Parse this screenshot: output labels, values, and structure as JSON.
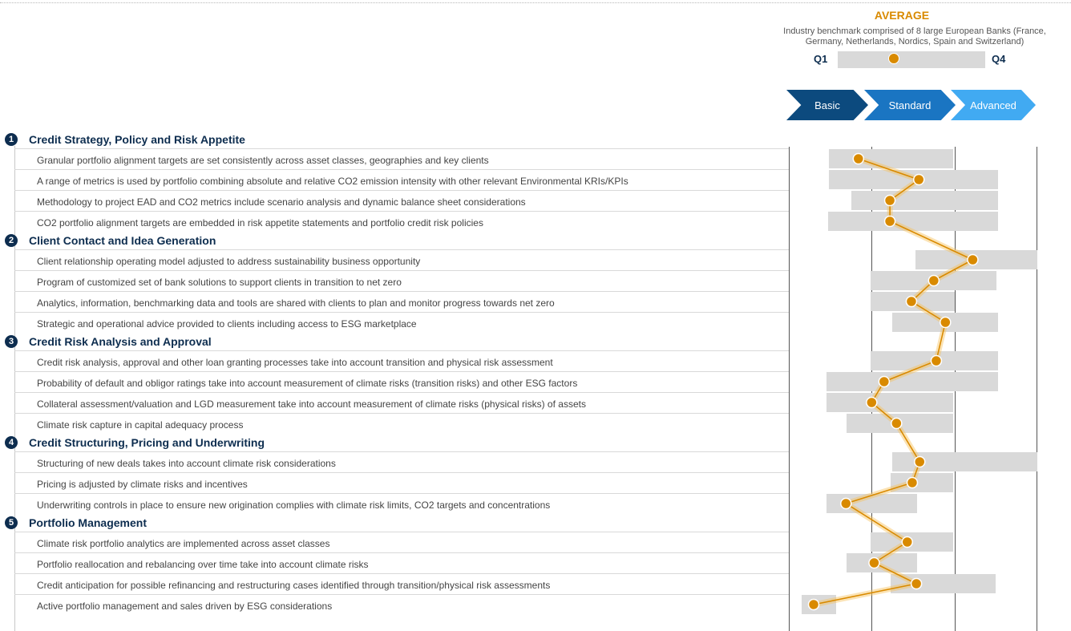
{
  "legend": {
    "title": "AVERAGE",
    "subtitle_line1": "Industry benchmark comprised of 8 large European Banks (France,",
    "subtitle_line2": "Germany, Netherlands, Nordics, Spain and Switzerland)",
    "q1": "Q1",
    "q4": "Q4",
    "sample_average": 0.38
  },
  "maturity_levels": [
    "Basic",
    "Standard",
    "Advanced"
  ],
  "colors": {
    "navy": "#0d2d4f",
    "basic": "#0c4a7e",
    "standard": "#1a75c2",
    "advanced": "#41aaf2",
    "average_marker": "#d98a00",
    "quartile_band": "#d9d9d9"
  },
  "chart_data": {
    "type": "scatter",
    "x_scale": "maturity score, 0 = left edge of Basic column, 3 = right edge of Advanced column",
    "xlim": [
      0,
      3
    ],
    "categories": [
      "Basic",
      "Standard",
      "Advanced"
    ],
    "sections": [
      {
        "num": "1",
        "title": "Credit Strategy, Policy and Risk Appetite",
        "items": [
          {
            "label": "Granular portfolio alignment targets are set consistently across asset classes, geographies and key clients",
            "avg": 0.84,
            "q1": 0.48,
            "q4": 1.98
          },
          {
            "label": "A range of metrics is used by portfolio combining absolute and relative CO2 emission intensity with other relevant Environmental KRIs/KPIs",
            "avg": 1.57,
            "q1": 0.48,
            "q4": 2.53
          },
          {
            "label": "Methodology to project EAD and CO2 metrics include scenario analysis and dynamic balance sheet considerations",
            "avg": 1.22,
            "q1": 0.75,
            "q4": 2.53
          },
          {
            "label": "CO2 portfolio alignment targets are embedded in risk appetite statements and portfolio credit risk policies",
            "avg": 1.22,
            "q1": 0.47,
            "q4": 2.53
          }
        ]
      },
      {
        "num": "2",
        "title": "Client Contact and Idea Generation",
        "items": [
          {
            "label": "Client relationship operating model adjusted to address sustainability business opportunity",
            "avg": 2.22,
            "q1": 1.53,
            "q4": 3.0
          },
          {
            "label": "Program of customized set of bank solutions to support clients in transition to net zero",
            "avg": 1.75,
            "q1": 0.99,
            "q4": 2.51
          },
          {
            "label": "Analytics, information, benchmarking data and tools are shared with clients to plan and monitor progress towards net zero",
            "avg": 1.48,
            "q1": 0.99,
            "q4": 2.0
          },
          {
            "label": "Strategic and operational advice provided to clients including access to ESG marketplace",
            "avg": 1.89,
            "q1": 1.25,
            "q4": 2.53
          }
        ]
      },
      {
        "num": "3",
        "title": "Credit Risk Analysis and Approval",
        "items": [
          {
            "label": "Credit risk analysis, approval and other loan granting processes take into account transition and physical risk assessment",
            "avg": 1.78,
            "q1": 0.99,
            "q4": 2.53
          },
          {
            "label": "Probability of default and obligor ratings take into account measurement of climate risks (transition risks) and other ESG factors",
            "avg": 1.15,
            "q1": 0.45,
            "q4": 2.53
          },
          {
            "label": "Collateral assessment/valuation and LGD measurement take into account measurement of climate risks (physical risks) of assets",
            "avg": 1.0,
            "q1": 0.45,
            "q4": 1.98
          },
          {
            "label": "Climate risk capture in capital adequacy process",
            "avg": 1.3,
            "q1": 0.7,
            "q4": 1.98
          }
        ]
      },
      {
        "num": "4",
        "title": "Credit Structuring, Pricing and Underwriting",
        "items": [
          {
            "label": "Structuring of new deals takes into account climate risk considerations",
            "avg": 1.58,
            "q1": 1.25,
            "q4": 3.0
          },
          {
            "label": "Pricing is adjusted by climate risks and incentives",
            "avg": 1.49,
            "q1": 1.23,
            "q4": 1.98
          },
          {
            "label": "Underwriting controls in place to ensure new origination complies with climate risk limits, CO2 targets and concentrations",
            "avg": 0.69,
            "q1": 0.45,
            "q4": 1.55
          }
        ]
      },
      {
        "num": "5",
        "title": "Portfolio Management",
        "items": [
          {
            "label": "Climate risk portfolio analytics are implemented across asset classes",
            "avg": 1.43,
            "q1": 0.99,
            "q4": 1.98
          },
          {
            "label": "Portfolio reallocation and rebalancing over time take into account climate risks",
            "avg": 1.03,
            "q1": 0.7,
            "q4": 1.55
          },
          {
            "label": "Credit anticipation for possible refinancing and restructuring cases identified through transition/physical risk assessments",
            "avg": 1.54,
            "q1": 1.23,
            "q4": 2.5
          },
          {
            "label": "Active portfolio management and sales driven by ESG considerations",
            "avg": 0.3,
            "q1": 0.15,
            "q4": 0.57
          }
        ]
      }
    ]
  }
}
